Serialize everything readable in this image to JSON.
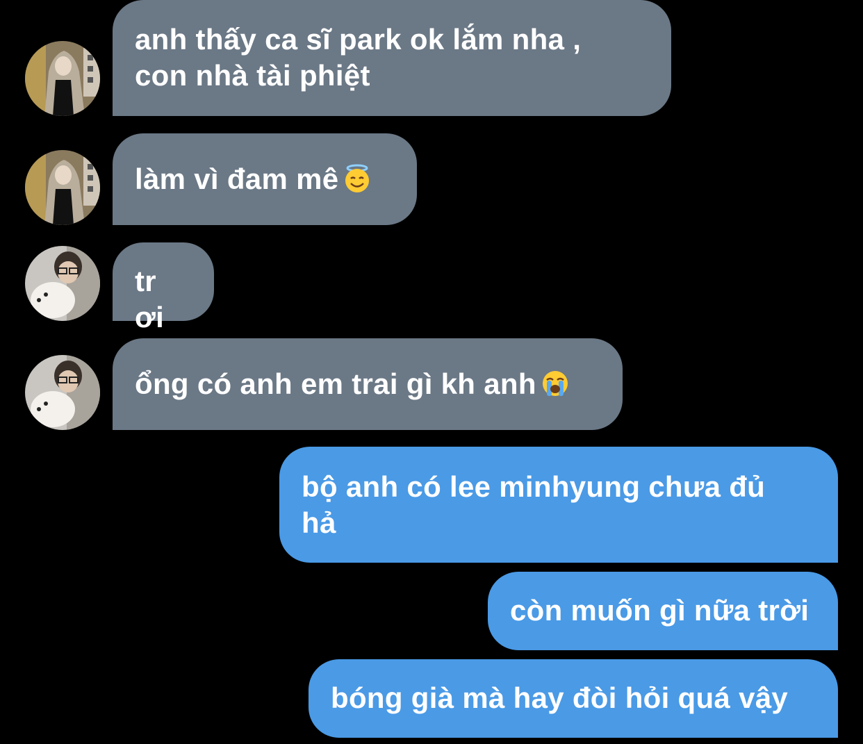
{
  "messages": [
    {
      "sender": "other",
      "text": "anh thấy ca sĩ park ok lắm nha ,\ncon nhà tài phiệt",
      "emoji": ""
    },
    {
      "sender": "other",
      "text": "làm vì đam mê",
      "emoji": "smiling-face-with-halo"
    },
    {
      "sender": "other",
      "text": "tr ơi",
      "emoji": ""
    },
    {
      "sender": "other",
      "text": "ổng có anh em trai gì kh anh",
      "emoji": "loudly-crying-face"
    },
    {
      "sender": "me",
      "text": "bộ anh có lee minhyung chưa đủ\nhả",
      "emoji": ""
    },
    {
      "sender": "me",
      "text": "còn muốn gì nữa trời",
      "emoji": ""
    },
    {
      "sender": "me",
      "text": "bóng già mà hay đòi hỏi quá vậy",
      "emoji": ""
    }
  ],
  "colors": {
    "background": "#000000",
    "incoming_bubble": "#6b7886",
    "outgoing_bubble": "#4a9ae6",
    "text": "#ffffff"
  },
  "icons": {
    "avatar_1": "person-in-hooded-coat-avatar",
    "avatar_2": "person-with-glasses-and-dog-avatar"
  }
}
